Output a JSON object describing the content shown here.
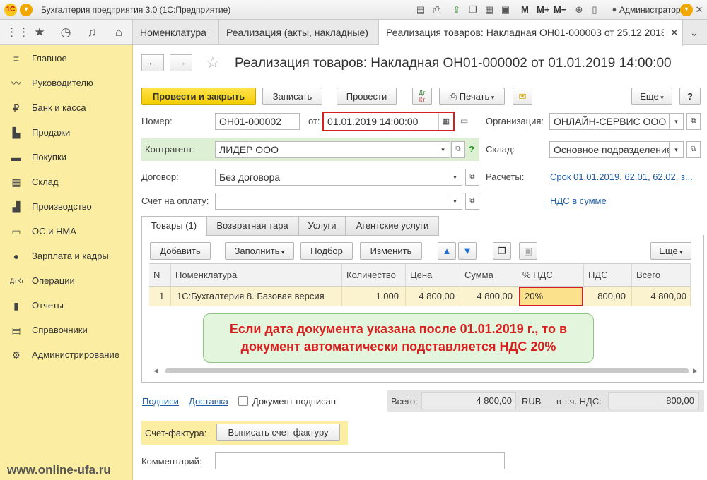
{
  "titlebar": {
    "app_title": "Бухгалтерия предприятия 3.0  (1С:Предприятие)",
    "logo_text": "1С",
    "m_label": "M",
    "mplus_label": "M+",
    "mminus_label": "M−",
    "user": "Администратор"
  },
  "tabs": [
    {
      "label": "Номенклатура"
    },
    {
      "label": "Реализация (акты, накладные)"
    },
    {
      "label": "Реализация товаров: Накладная ОН01-000003 от 25.12.2018..."
    }
  ],
  "sidebar": {
    "items": [
      {
        "label": "Главное",
        "icon": "menu-lines-icon"
      },
      {
        "label": "Руководителю",
        "icon": "trend-icon"
      },
      {
        "label": "Банк и касса",
        "icon": "ruble-coin-icon"
      },
      {
        "label": "Продажи",
        "icon": "shopping-bag-icon"
      },
      {
        "label": "Покупки",
        "icon": "cart-icon"
      },
      {
        "label": "Склад",
        "icon": "warehouse-icon"
      },
      {
        "label": "Производство",
        "icon": "factory-icon"
      },
      {
        "label": "ОС и НМА",
        "icon": "truck-icon"
      },
      {
        "label": "Зарплата и кадры",
        "icon": "person-icon"
      },
      {
        "label": "Операции",
        "icon": "dt-kt-icon"
      },
      {
        "label": "Отчеты",
        "icon": "bar-chart-icon"
      },
      {
        "label": "Справочники",
        "icon": "book-icon"
      },
      {
        "label": "Администрирование",
        "icon": "gear-icon"
      }
    ],
    "watermark": "www.online-ufa.ru"
  },
  "form": {
    "title": "Реализация товаров: Накладная ОН01-000002 от 01.01.2019 14:00:00",
    "toolbar": {
      "post_close": "Провести и закрыть",
      "save": "Записать",
      "post": "Провести",
      "dtkt_top": "Дт",
      "dtkt_bottom": "Кт",
      "print": "Печать",
      "more": "Еще",
      "help": "?"
    },
    "number_label": "Номер:",
    "number_value": "ОН01-000002",
    "date_label": "от:",
    "date_value": "01.01.2019 14:00:00",
    "org_label": "Организация:",
    "org_value": "ОНЛАЙН-СЕРВИС ООО",
    "counterparty_label": "Контрагент:",
    "counterparty_value": "ЛИДЕР ООО",
    "counterparty_help": "?",
    "warehouse_label": "Склад:",
    "warehouse_value": "Основное подразделение",
    "contract_label": "Договор:",
    "contract_value": "Без договора",
    "settlements_label": "Расчеты:",
    "settlements_link": "Срок 01.01.2019, 62.01, 62.02, з...",
    "invoice_pay_label": "Счет на оплату:",
    "invoice_pay_value": "",
    "vat_link": "НДС в сумме"
  },
  "doc_tabs": [
    {
      "label": "Товары (1)"
    },
    {
      "label": "Возвратная тара"
    },
    {
      "label": "Услуги"
    },
    {
      "label": "Агентские услуги"
    }
  ],
  "table_toolbar": {
    "add": "Добавить",
    "fill": "Заполнить",
    "pick": "Подбор",
    "change": "Изменить",
    "more": "Еще"
  },
  "table": {
    "columns": [
      "N",
      "Номенклатура",
      "Количество",
      "Цена",
      "Сумма",
      "% НДС",
      "НДС",
      "Всего"
    ],
    "rows": [
      {
        "n": "1",
        "item": "1С:Бухгалтерия 8. Базовая версия",
        "qty": "1,000",
        "price": "4 800,00",
        "sum": "4 800,00",
        "vat_rate": "20%",
        "vat": "800,00",
        "total": "4 800,00"
      }
    ]
  },
  "callout": {
    "line1": "Если дата документа указана после 01.01.2019 г., то в",
    "line2": "документ автоматически подставляется НДС 20%"
  },
  "footer": {
    "signatures_link": "Подписи",
    "delivery_link": "Доставка",
    "signed_label": "Документ подписан",
    "total_label": "Всего:",
    "total_value": "4 800,00",
    "currency": "RUB",
    "vat_label": "в т.ч. НДС:",
    "vat_value": "800,00",
    "invoice_label": "Счет-фактура:",
    "invoice_button": "Выписать счет-фактуру",
    "comment_label": "Комментарий:",
    "comment_value": ""
  },
  "colors": {
    "sidebar": "#fbeea2",
    "primary_button": "#f5cc00",
    "highlight_border": "#d81f1f",
    "callout_bg": "#e4f5dd",
    "link": "#1d5aa4"
  }
}
